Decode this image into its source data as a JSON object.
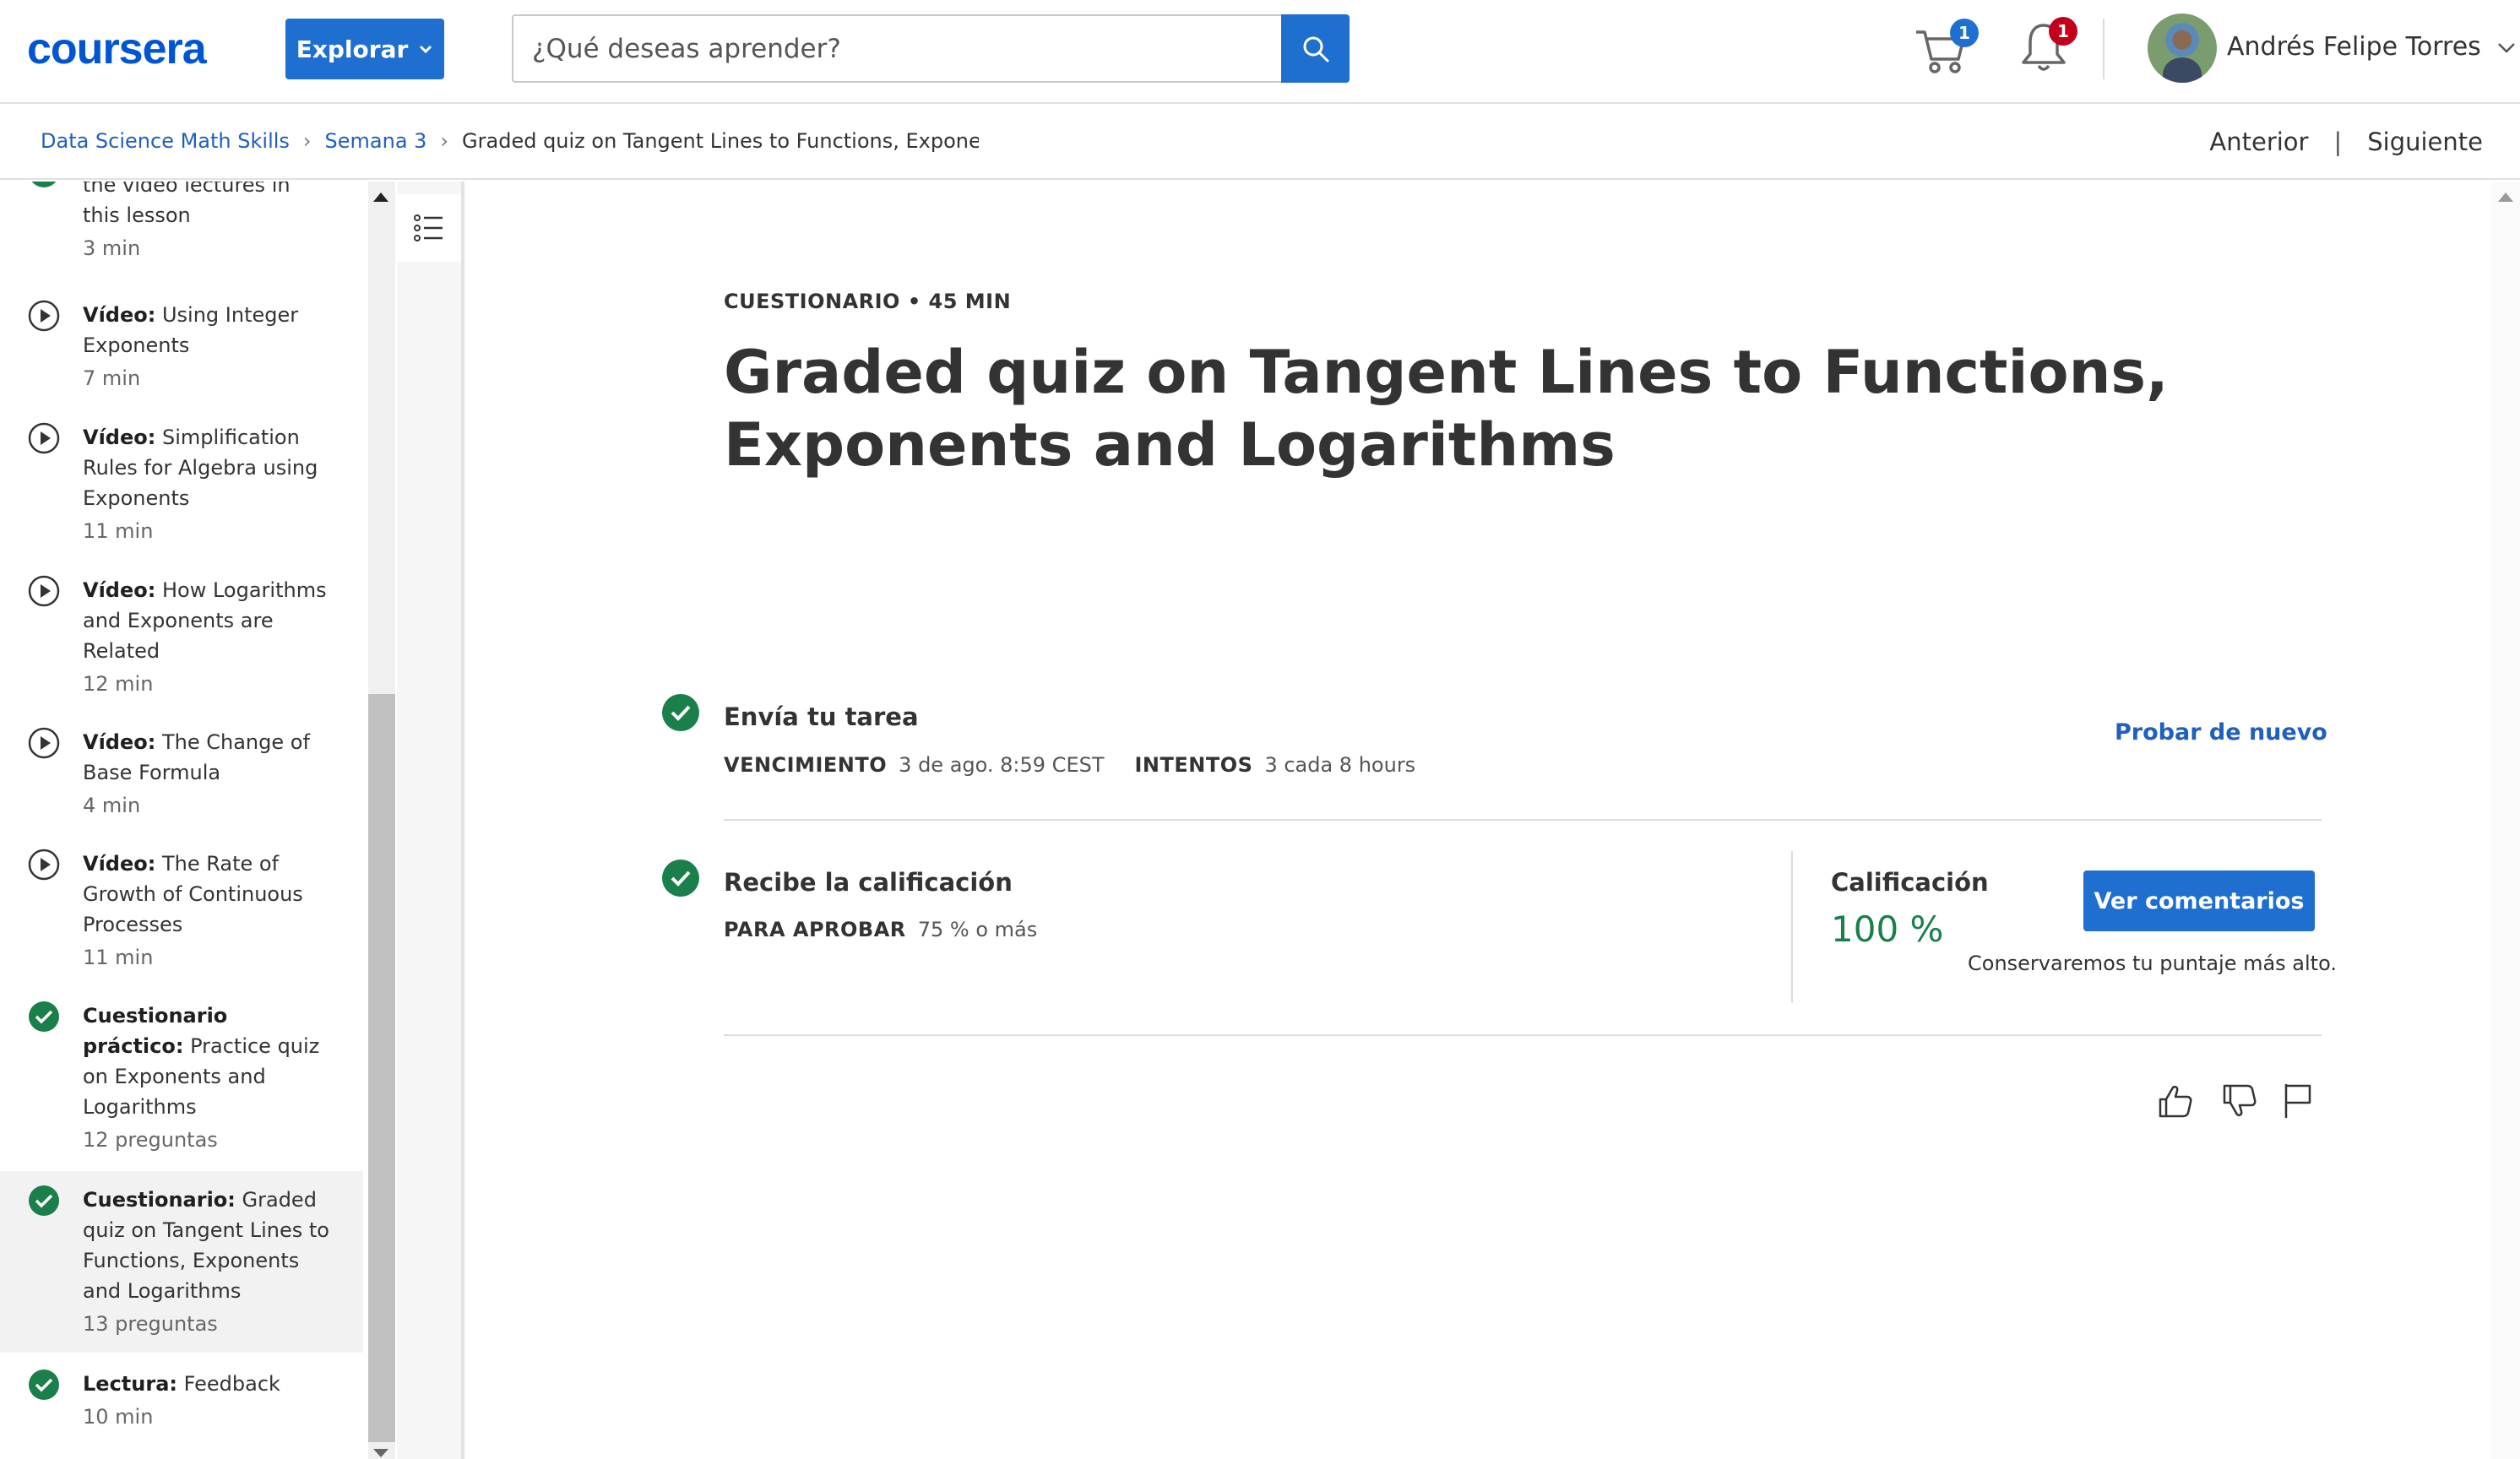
{
  "header": {
    "logo": "coursera",
    "explore_label": "Explorar",
    "search_placeholder": "¿Qué deseas aprender?",
    "cart_count": "1",
    "notifications_count": "1",
    "user_name": "Andrés Felipe Torres"
  },
  "breadcrumb": {
    "course": "Data Science Math Skills",
    "week": "Semana 3",
    "current": "Graded quiz on Tangent Lines to Functions, Exponents"
  },
  "nav": {
    "previous": "Anterior",
    "separator": "|",
    "next": "Siguiente"
  },
  "sidebar": {
    "items": [
      {
        "prefix": "",
        "title": "the video lectures in this lesson",
        "meta": "3 min",
        "icon": "check-circle-icon"
      },
      {
        "prefix": "Vídeo:",
        "title": " Using Integer Exponents",
        "meta": "7 min",
        "icon": "play-circle-icon"
      },
      {
        "prefix": "Vídeo:",
        "title": " Simplification Rules for Algebra using Exponents",
        "meta": "11 min",
        "icon": "play-circle-icon"
      },
      {
        "prefix": "Vídeo:",
        "title": " How Logarithms and Exponents are Related",
        "meta": "12 min",
        "icon": "play-circle-icon"
      },
      {
        "prefix": "Vídeo:",
        "title": " The Change of Base Formula",
        "meta": "4 min",
        "icon": "play-circle-icon"
      },
      {
        "prefix": "Vídeo:",
        "title": " The Rate of Growth of Continuous Processes",
        "meta": "11 min",
        "icon": "play-circle-icon"
      },
      {
        "prefix": "Cuestionario práctico:",
        "title": " Practice quiz on Exponents and Logarithms",
        "meta": "12 preguntas",
        "icon": "check-circle-icon"
      },
      {
        "prefix": "Cuestionario:",
        "title": " Graded quiz on Tangent Lines to Functions, Exponents and Logarithms",
        "meta": "13 preguntas",
        "icon": "check-circle-icon"
      },
      {
        "prefix": "Lectura:",
        "title": " Feedback",
        "meta": "10 min",
        "icon": "check-circle-icon"
      }
    ]
  },
  "main": {
    "kicker": "CUESTIONARIO • 45 MIN",
    "title": "Graded quiz on Tangent Lines to Functions, Exponents and Logarithms",
    "submit": {
      "title": "Envía tu tarea",
      "due_label": "VENCIMIENTO",
      "due_value": "3 de ago. 8:59 CEST",
      "attempts_label": "INTENTOS",
      "attempts_value": "3 cada 8 hours",
      "retry": "Probar de nuevo"
    },
    "grade": {
      "title": "Recibe la calificación",
      "pass_label": "PARA APROBAR",
      "pass_value": "75 % o más",
      "grade_label": "Calificación",
      "grade_value": "100 %",
      "feedback_button": "Ver comentarios",
      "keep_note": "Conservaremos tu puntaje más alto."
    }
  },
  "colors": {
    "brand_blue": "#0056d2",
    "button_blue": "#1f6fd1",
    "success_green": "#1a7f4b",
    "badge_red": "#c2001b"
  }
}
